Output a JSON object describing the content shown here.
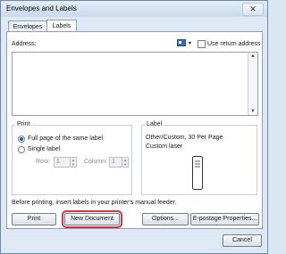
{
  "window": {
    "title": "Envelopes and Labels",
    "close_glyph": "✕"
  },
  "tabs": [
    {
      "label": "Envelopes",
      "mnemonic_index": 0
    },
    {
      "label": "Labels",
      "mnemonic_index": 0
    }
  ],
  "address": {
    "label": "Address:",
    "use_return_address_label": "Use return address",
    "use_return_address_checked": false,
    "value": ""
  },
  "print_group": {
    "title": "Print",
    "options": [
      {
        "label": "Full page of the same label",
        "checked": true
      },
      {
        "label": "Single label",
        "checked": false
      }
    ],
    "row_label": "Row:",
    "row_value": "1",
    "column_label": "Column:",
    "column_value": "1"
  },
  "label_group": {
    "title": "Label",
    "line1": "Other/Custom, 30 Per Page",
    "line2": "Custom laser"
  },
  "notice": "Before printing, insert labels in your printer's manual feeder.",
  "buttons": {
    "print": "Print",
    "new_document": "New Document",
    "options": "Options...",
    "epostage": "E-postage Properties...",
    "cancel": "Cancel"
  },
  "colors": {
    "highlight": "#d9343b",
    "accent": "#2c5aa0"
  }
}
